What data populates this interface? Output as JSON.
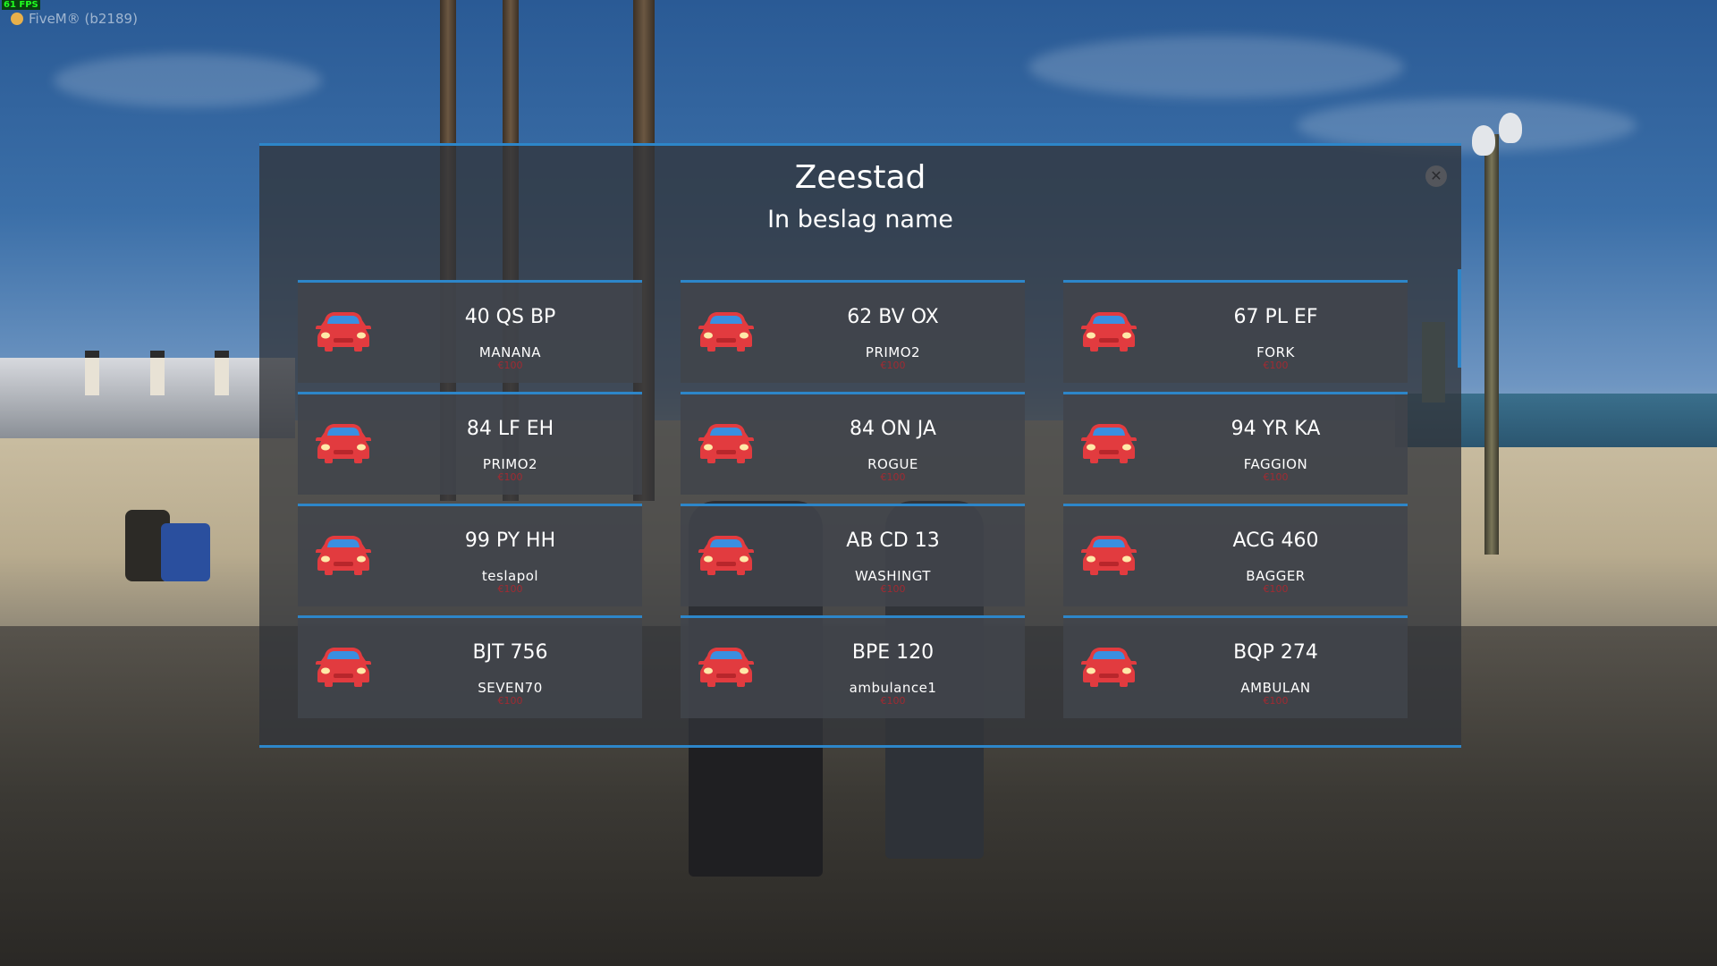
{
  "overlay": {
    "fps": "61 FPS",
    "client": "FiveM® (b2189)"
  },
  "panel": {
    "title": "Zeestad",
    "subtitle": "In beslag name",
    "close_icon": "close-icon",
    "accent_color": "#2d86c9"
  },
  "vehicles": [
    {
      "plate": "40 QS BP",
      "model": "MANANA",
      "price": "€100",
      "icon": "car-icon"
    },
    {
      "plate": "62 BV OX",
      "model": "PRIMO2",
      "price": "€100",
      "icon": "car-icon"
    },
    {
      "plate": "67 PL EF",
      "model": "FORK",
      "price": "€100",
      "icon": "car-icon"
    },
    {
      "plate": "84 LF EH",
      "model": "PRIMO2",
      "price": "€100",
      "icon": "car-icon"
    },
    {
      "plate": "84 ON JA",
      "model": "ROGUE",
      "price": "€100",
      "icon": "car-icon"
    },
    {
      "plate": "94 YR KA",
      "model": "FAGGION",
      "price": "€100",
      "icon": "car-icon"
    },
    {
      "plate": "99 PY HH",
      "model": "teslapol",
      "price": "€100",
      "icon": "car-icon"
    },
    {
      "plate": "AB CD 13",
      "model": "WASHINGT",
      "price": "€100",
      "icon": "car-icon"
    },
    {
      "plate": "ACG 460",
      "model": "BAGGER",
      "price": "€100",
      "icon": "car-icon"
    },
    {
      "plate": "BJT 756",
      "model": "SEVEN70",
      "price": "€100",
      "icon": "car-icon"
    },
    {
      "plate": "BPE 120",
      "model": "ambulance1",
      "price": "€100",
      "icon": "car-icon"
    },
    {
      "plate": "BQP 274",
      "model": "AMBULAN",
      "price": "€100",
      "icon": "car-icon"
    }
  ]
}
